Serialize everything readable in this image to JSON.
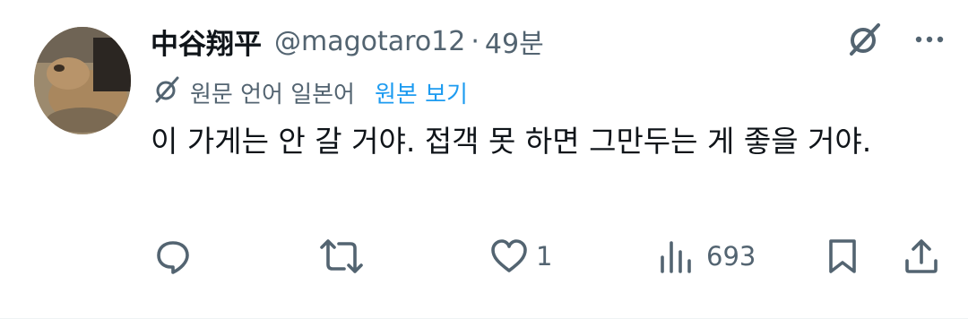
{
  "tweet": {
    "author_name": "中谷翔平",
    "author_handle": "@magotaro12",
    "separator": "·",
    "time": "49분",
    "translation": {
      "label": "원문 언어 일본어",
      "show_original": "원본 보기"
    },
    "text": "이 가게는 안 갈 거야. 접객 못 하면 그만두는 게 좋을 거야.",
    "stats": {
      "replies": "",
      "retweets": "",
      "likes": "1",
      "views": "693"
    }
  },
  "colors": {
    "text_primary": "#0f1419",
    "text_secondary": "#536471",
    "link": "#1d9bf0"
  },
  "icons": [
    "grok-icon",
    "more-icon",
    "translate-icon",
    "reply-icon",
    "retweet-icon",
    "like-icon",
    "views-icon",
    "bookmark-icon",
    "share-icon"
  ]
}
